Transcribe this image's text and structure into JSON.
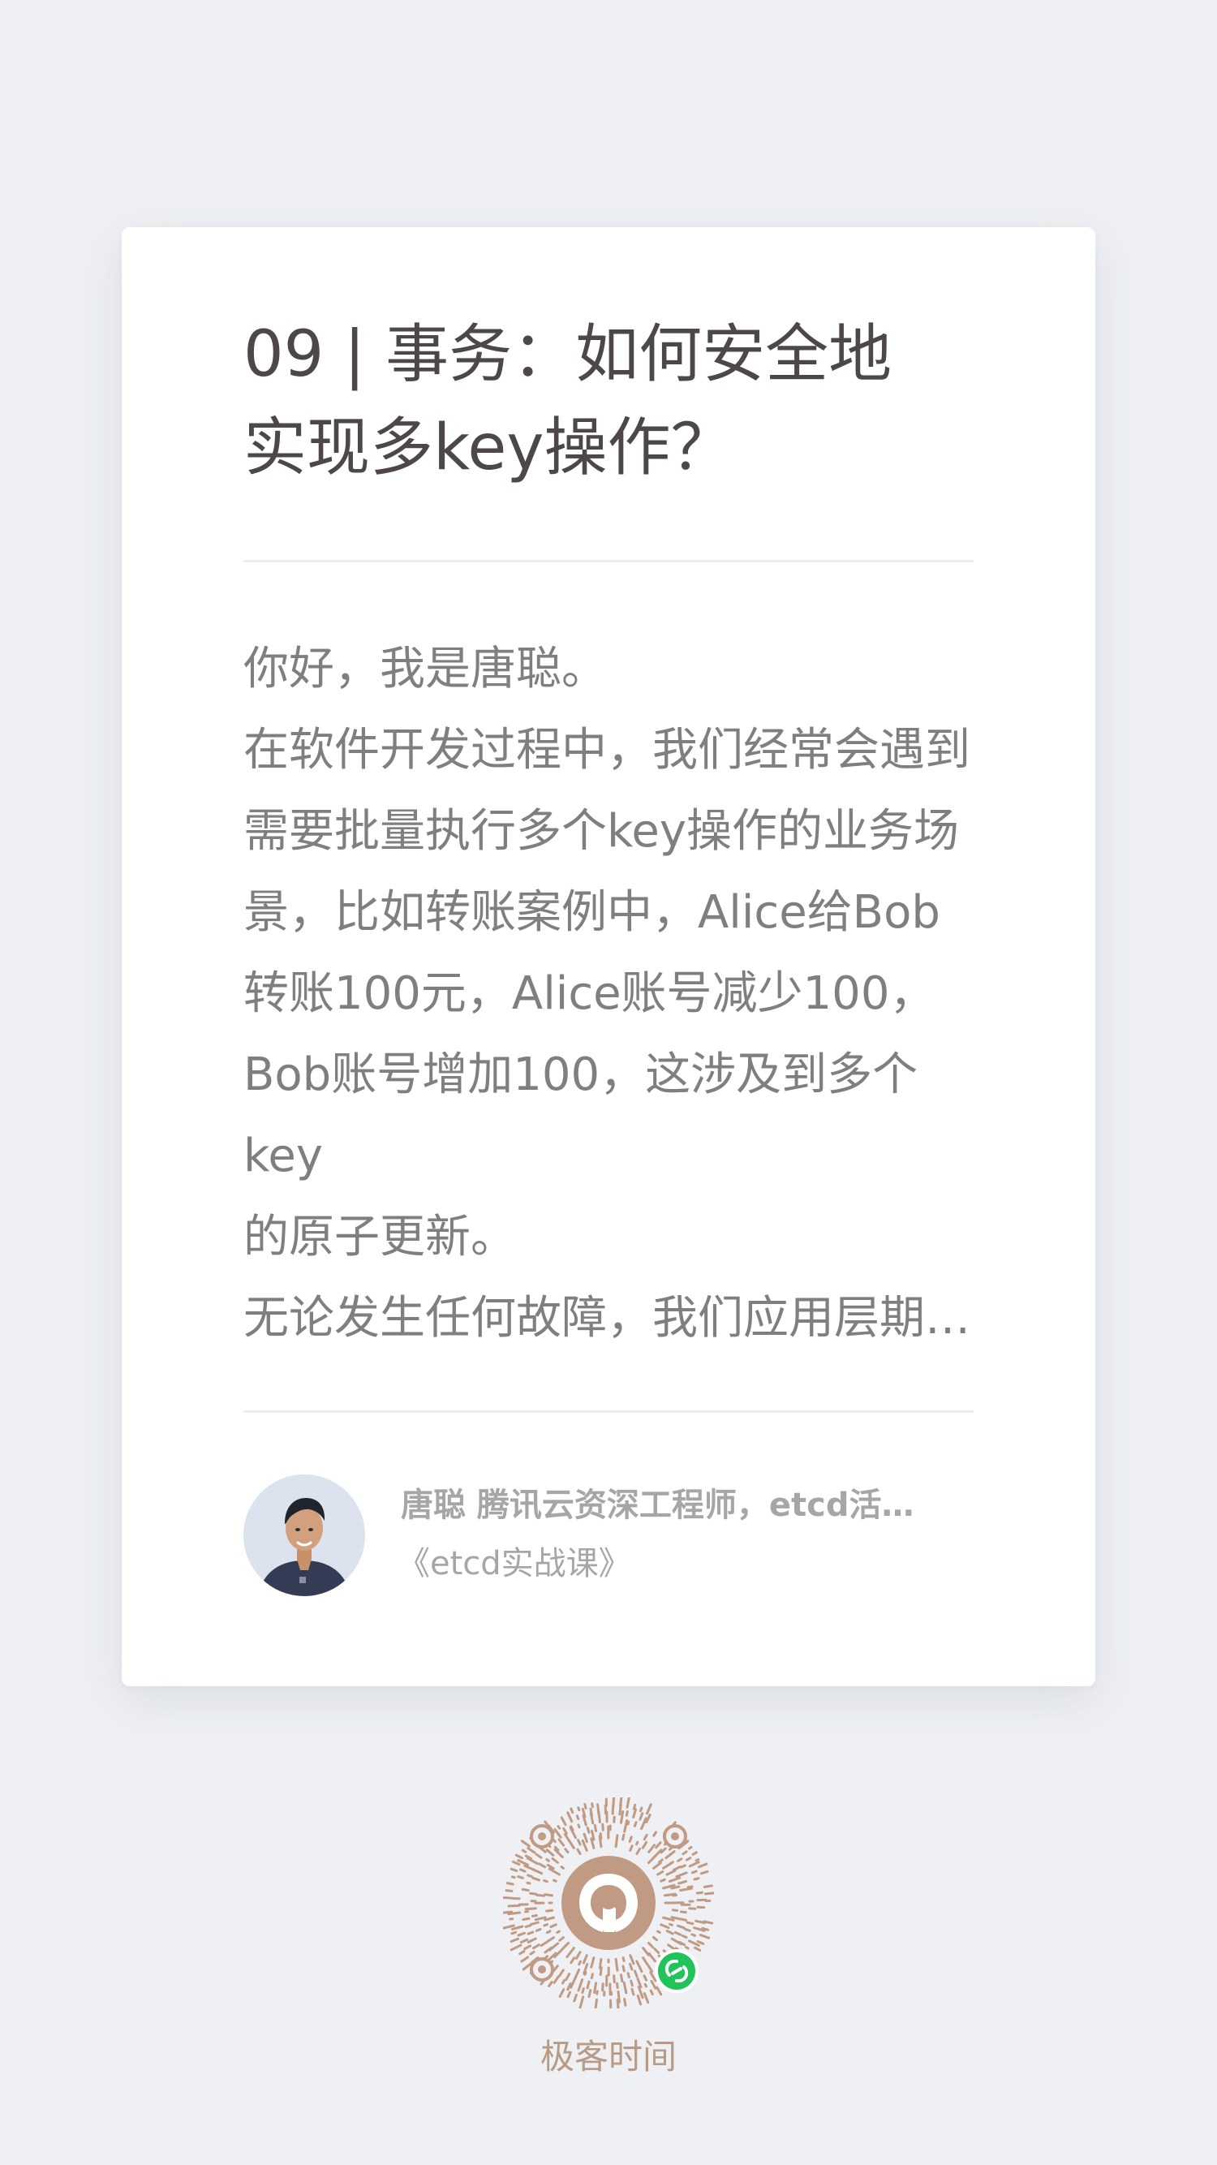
{
  "article": {
    "title": "09 | 事务：如何安全地\n实现多key操作？",
    "excerpt": "你好，我是唐聪。\n在软件开发过程中，我们经常会遇到\n需要批量执行多个key操作的业务场\n景，比如转账案例中，Alice给Bob\n转账100元，Alice账号减少100，\nBob账号增加100，这涉及到多个key\n的原子更新。\n无论发生任何故障，我们应用层期…"
  },
  "author": {
    "name_and_title": "唐聪  腾讯云资深工程师，etcd活…",
    "course": "《etcd实战课》"
  },
  "footer": {
    "brand": "极客时间"
  },
  "colors": {
    "background": "#eef0f4",
    "card": "#ffffff",
    "title": "#4d4747",
    "body_text": "#7f7f7f",
    "meta_text": "#a6a6a6",
    "brand": "#b89b86",
    "qr": "#c09a82",
    "badge": "#21c35b"
  },
  "icons": {
    "avatar": "author-avatar-photo",
    "qr_code": "mini-program-qr-code",
    "badge": "mini-program-link-icon"
  }
}
